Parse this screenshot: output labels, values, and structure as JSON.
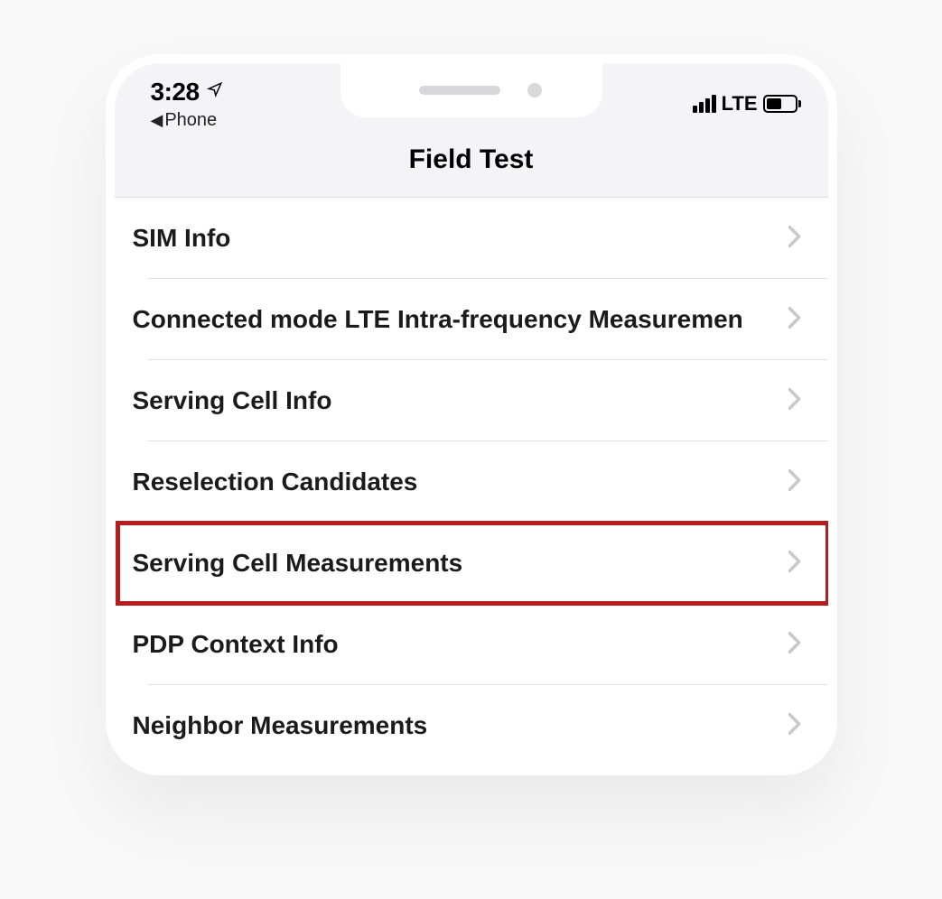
{
  "status": {
    "time": "3:28",
    "back_label": "Phone",
    "network": "LTE"
  },
  "nav": {
    "title": "Field Test"
  },
  "items": [
    {
      "label": "SIM Info",
      "highlighted": false
    },
    {
      "label": "Connected mode LTE Intra-frequency Measuremen",
      "highlighted": false
    },
    {
      "label": "Serving Cell Info",
      "highlighted": false
    },
    {
      "label": "Reselection Candidates",
      "highlighted": false
    },
    {
      "label": "Serving Cell Measurements",
      "highlighted": true
    },
    {
      "label": "PDP Context Info",
      "highlighted": false
    },
    {
      "label": "Neighbor Measurements",
      "highlighted": false
    }
  ]
}
